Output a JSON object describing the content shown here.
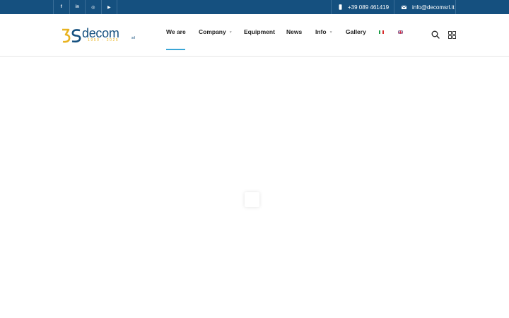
{
  "topbar": {
    "social": [
      {
        "name": "facebook",
        "glyph": "f"
      },
      {
        "name": "linkedin",
        "glyph": "in"
      },
      {
        "name": "instagram",
        "glyph": "◎"
      },
      {
        "name": "youtube",
        "glyph": "▶"
      }
    ],
    "phone": "+39 089 461419",
    "email": "info@decomsrl.it"
  },
  "logo": {
    "text": "decom",
    "suffix": "srl",
    "years": "1950 - 2025"
  },
  "nav": {
    "items": [
      {
        "label": "We are",
        "active": true,
        "dropdown": false
      },
      {
        "label": "Company",
        "active": false,
        "dropdown": true
      },
      {
        "label": "Equipment",
        "active": false,
        "dropdown": false
      },
      {
        "label": "News",
        "active": false,
        "dropdown": false
      },
      {
        "label": "Info",
        "active": false,
        "dropdown": true
      },
      {
        "label": "Gallery",
        "active": false,
        "dropdown": false
      }
    ],
    "caret": "▼",
    "languages": [
      "italian",
      "english"
    ]
  },
  "header_icons": [
    "search-icon",
    "grid-menu-icon"
  ],
  "colors": {
    "topbar": "#15507f",
    "accent": "#3aa6d6",
    "logo_blue": "#15507f",
    "logo_gold": "#e8b321"
  }
}
